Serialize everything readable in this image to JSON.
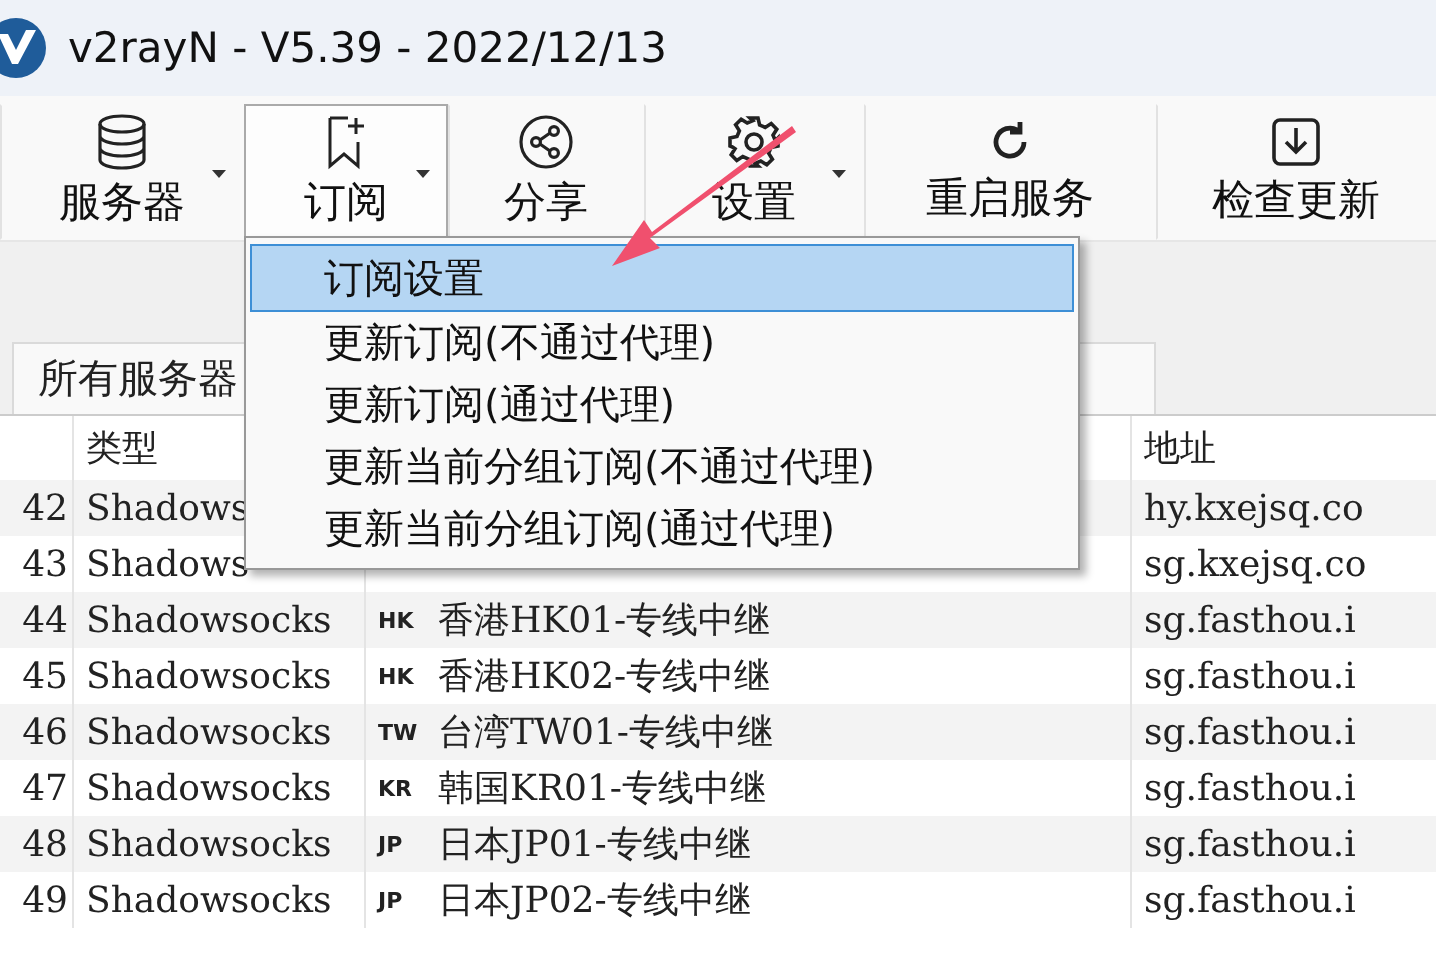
{
  "window": {
    "title": "v2rayN - V5.39 - 2022/12/13"
  },
  "toolbar": {
    "buttons": [
      {
        "label": "服务器",
        "dropdown": true,
        "pressed": false
      },
      {
        "label": "订阅",
        "dropdown": true,
        "pressed": true
      },
      {
        "label": "分享",
        "dropdown": false,
        "pressed": false
      },
      {
        "label": "设置",
        "dropdown": true,
        "pressed": false
      },
      {
        "label": "重启服务",
        "dropdown": false,
        "pressed": false
      },
      {
        "label": "检查更新",
        "dropdown": false,
        "pressed": false
      }
    ]
  },
  "tabs": [
    {
      "label": "所有服务器",
      "selected": true
    }
  ],
  "table": {
    "columns": [
      "类型",
      "地址"
    ],
    "rows": [
      {
        "index": "42",
        "type": "Shadows",
        "address": "hy.kxejsq.co"
      },
      {
        "index": "43",
        "type": "Shadows",
        "address": "sg.kxejsq.co"
      },
      {
        "index": "44",
        "type": "Shadowsocks",
        "flag": "HK",
        "remarks": "香港HK01-专线中继",
        "address": "sg.fasthou.i"
      },
      {
        "index": "45",
        "type": "Shadowsocks",
        "flag": "HK",
        "remarks": "香港HK02-专线中继",
        "address": "sg.fasthou.i"
      },
      {
        "index": "46",
        "type": "Shadowsocks",
        "flag": "TW",
        "remarks": "台湾TW01-专线中继",
        "address": "sg.fasthou.i"
      },
      {
        "index": "47",
        "type": "Shadowsocks",
        "flag": "KR",
        "remarks": "韩国KR01-专线中继",
        "address": "sg.fasthou.i"
      },
      {
        "index": "48",
        "type": "Shadowsocks",
        "flag": "JP",
        "remarks": "日本JP01-专线中继",
        "address": "sg.fasthou.i"
      },
      {
        "index": "49",
        "type": "Shadowsocks",
        "flag": "JP",
        "remarks": "日本JP02-专线中继",
        "address": "sg.fasthou.i"
      }
    ]
  },
  "menu": {
    "items": [
      {
        "label": "订阅设置",
        "selected": true
      },
      {
        "label": "更新订阅(不通过代理)",
        "selected": false
      },
      {
        "label": "更新订阅(通过代理)",
        "selected": false
      },
      {
        "label": "更新当前分组订阅(不通过代理)",
        "selected": false
      },
      {
        "label": "更新当前分组订阅(通过代理)",
        "selected": false
      }
    ]
  }
}
